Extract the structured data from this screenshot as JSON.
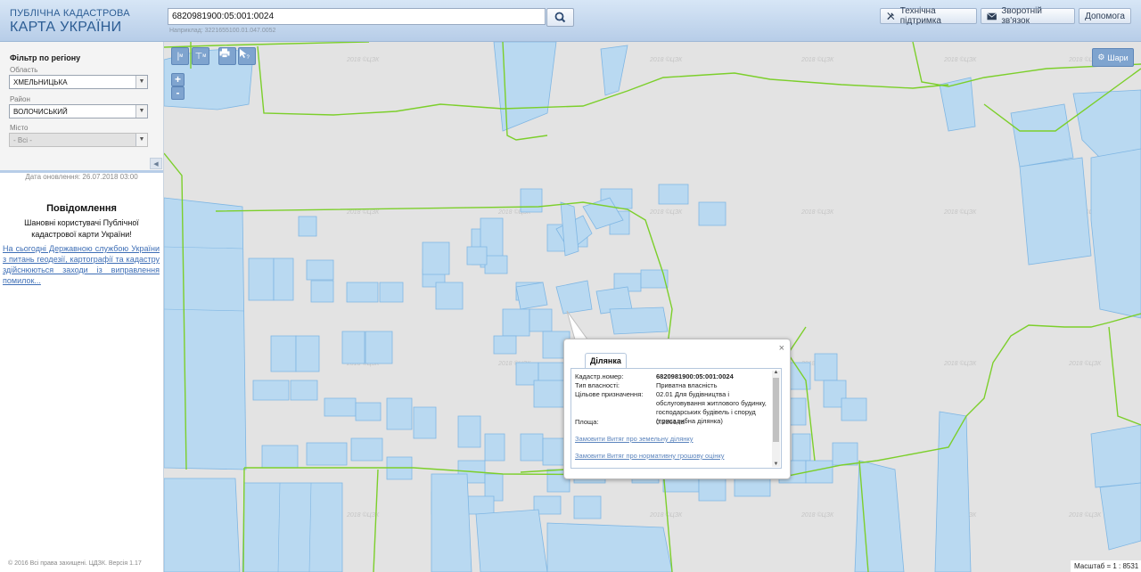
{
  "header": {
    "logo_line1": "ПУБЛІЧНА КАДАСТРОВА",
    "logo_line2": "КАРТА УКРАЇНИ",
    "search_value": "6820981900:05:001:0024",
    "search_hint": "Наприклад: 3221655100.01.047.0052",
    "support_label": "Технічна підтримка",
    "feedback_label": "Зворотній зв'язок",
    "help_label": "Допомога"
  },
  "sidebar": {
    "filter_title": "Фільтр по регіону",
    "region_label": "Область",
    "region_value": "ХМЕЛЬНИЦЬКА",
    "district_label": "Район",
    "district_value": "ВОЛОЧИСЬКИЙ",
    "city_label": "Місто",
    "city_value": "- Всі -",
    "update_date": "Дата оновлення: 26.07.2018 03:00",
    "notice_title": "Повідомлення",
    "notice_text": "Шановні користувачі Публічної кадастрової карти України!",
    "notice_link": "На сьогодні Державною службою України з питань геодезії, картографії та кадастру здійснюються заходи із виправлення помилок...",
    "copyright": "© 2016 Всі права захищені. ЦДЗК. Версія 1.17"
  },
  "map": {
    "tools": {
      "measure_line": "м",
      "measure_area": "м",
      "zoom_in": "+",
      "zoom_out": "-",
      "layers_label": "Шари"
    },
    "watermark": "2018 ©ЦЗК",
    "scale_label": "Масштаб = 1 : 8531",
    "colors": {
      "parcel_fill": "#b9d9f1",
      "parcel_stroke": "#7fb6e3",
      "boundary": "#7ccf2b",
      "map_bg": "#e3e3e3"
    }
  },
  "popup": {
    "tab_label": "Ділянка",
    "rows": [
      {
        "key": "Кадастр.номер:",
        "value": "6820981900:05:001:0024"
      },
      {
        "key": "Тип власності:",
        "value": "Приватна власність"
      },
      {
        "key": "Цільове призначення:",
        "value": "02.01 Для будівництва і обслуговування житлового будинку, господарських будівель і споруд (присадибна ділянка)"
      },
      {
        "key": "Площа:",
        "value": "0.2361 га"
      }
    ],
    "link1": "Замовити Витяг про земельну ділянку",
    "link2": "Замовити Витяг про нормативну грошову оцінку",
    "close": "×"
  }
}
